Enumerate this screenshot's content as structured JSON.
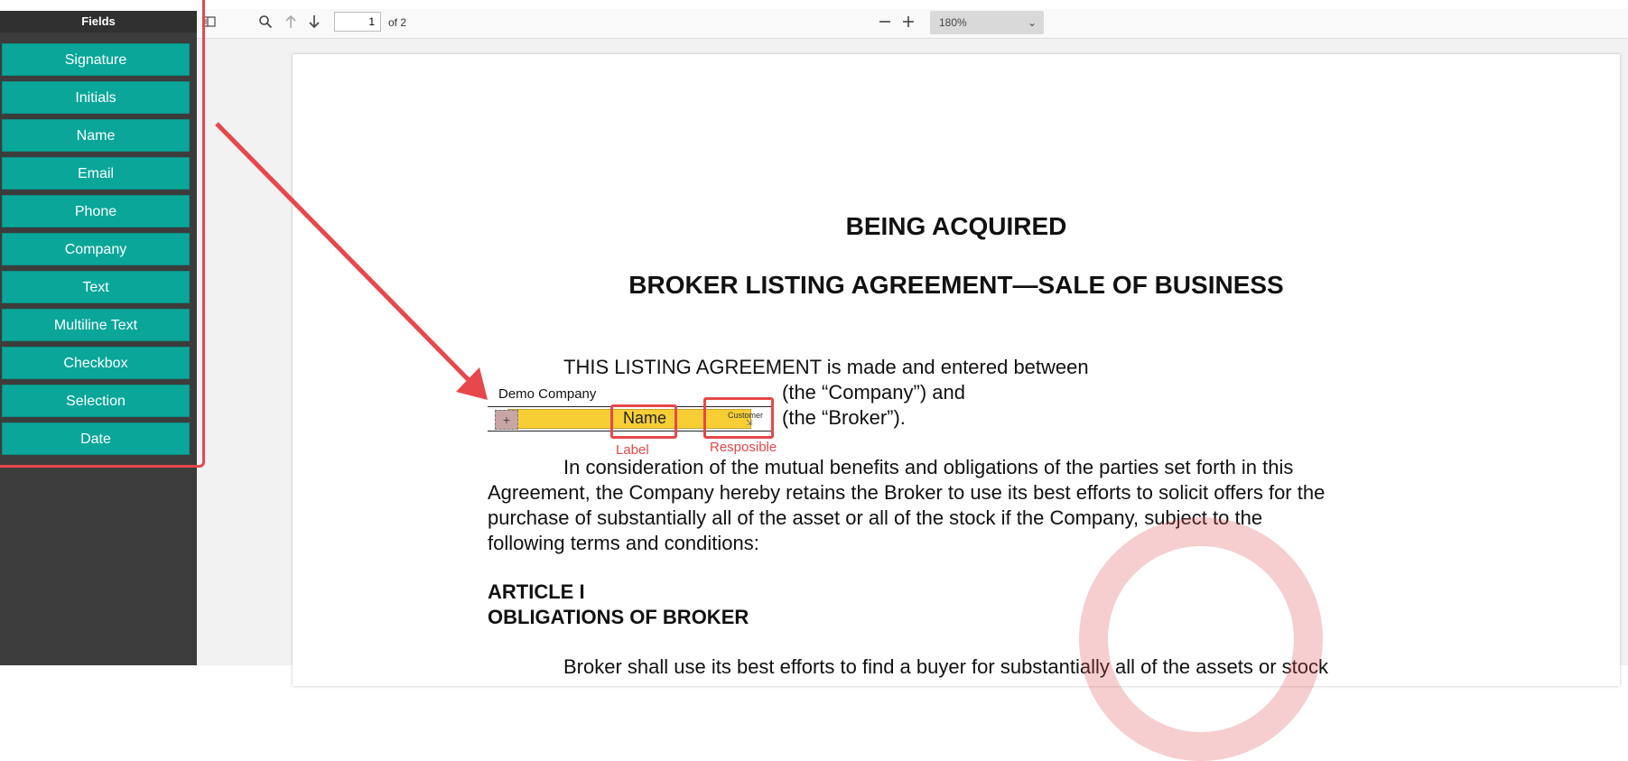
{
  "sidebar": {
    "title": "Fields",
    "items": [
      {
        "label": "Signature"
      },
      {
        "label": "Initials"
      },
      {
        "label": "Name"
      },
      {
        "label": "Email"
      },
      {
        "label": "Phone"
      },
      {
        "label": "Company"
      },
      {
        "label": "Text"
      },
      {
        "label": "Multiline Text"
      },
      {
        "label": "Checkbox"
      },
      {
        "label": "Selection"
      },
      {
        "label": "Date"
      }
    ]
  },
  "toolbar": {
    "page_current": "1",
    "page_total": "of 2",
    "zoom": "180%"
  },
  "document": {
    "heading1": "BEING ACQUIRED",
    "heading2": "BROKER LISTING AGREEMENT—SALE OF BUSINESS",
    "intro": "THIS LISTING AGREEMENT is made and entered between",
    "company_value": "Demo Company",
    "company_suffix": "(the “Company”) and",
    "broker_suffix": "(the “Broker”).",
    "field_label": "Name",
    "field_responsible": "Customer",
    "consideration_1": "In consideration of the mutual benefits and obligations of the parties set forth in this",
    "consideration_2": "Agreement, the Company hereby retains the Broker to use its best efforts to solicit offers for the",
    "consideration_3": "purchase of substantially all of the asset or all of the stock if the Company, subject to the",
    "consideration_4": "following terms and conditions:",
    "article": "ARTICLE I",
    "article_title": "OBLIGATIONS OF BROKER",
    "body_cut": "Broker shall use its best efforts to find a buyer for substantially all of the assets or stock"
  },
  "annotations": {
    "label_note": "Label",
    "responsible_note": "Resposible",
    "accent_color": "#e8474b"
  },
  "colors": {
    "field_button": "#0aa69a",
    "sidebar_bg": "#3c3c3c",
    "field_fill": "#f7cf35"
  }
}
